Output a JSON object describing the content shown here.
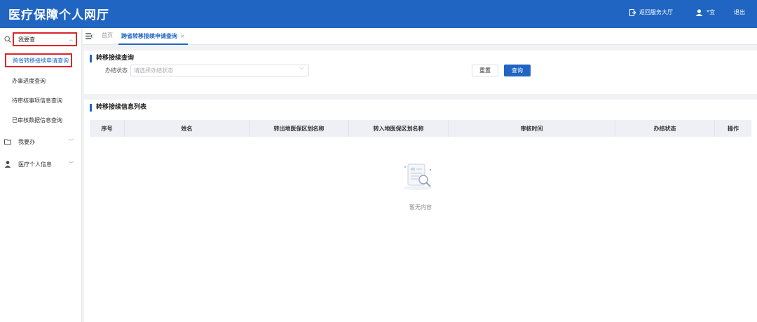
{
  "header": {
    "app_title": "医疗保障个人网厅",
    "return_label": "返回服务大厅",
    "user_label": "*宜",
    "logout_label": "退出"
  },
  "sidebar": {
    "group1": {
      "label": "我要查",
      "expanded": true
    },
    "items": [
      {
        "label": "跨省转移接续申请查询",
        "active": true
      },
      {
        "label": "办事进度查询"
      },
      {
        "label": "待审核事项信息查询"
      },
      {
        "label": "已审核数据信息查询"
      }
    ],
    "group2": {
      "label": "我要办"
    },
    "group3": {
      "label": "医疗个人信息"
    }
  },
  "tabs": {
    "home": "首页",
    "active": "跨省转移接续申请查询",
    "close": "×"
  },
  "query": {
    "title": "转移接续查询",
    "status_label": "办结状态",
    "status_placeholder": "请选择办结状态",
    "reset": "重置",
    "search": "查询"
  },
  "list": {
    "title": "转移接续信息列表",
    "columns": [
      "序号",
      "姓名",
      "转出地医保区划名称",
      "转入地医保区划名称",
      "审核时间",
      "办结状态",
      "操作"
    ],
    "empty_text": "暂无内容"
  },
  "colors": {
    "primary": "#1f65c1",
    "highlight_box": "#d9262c"
  }
}
